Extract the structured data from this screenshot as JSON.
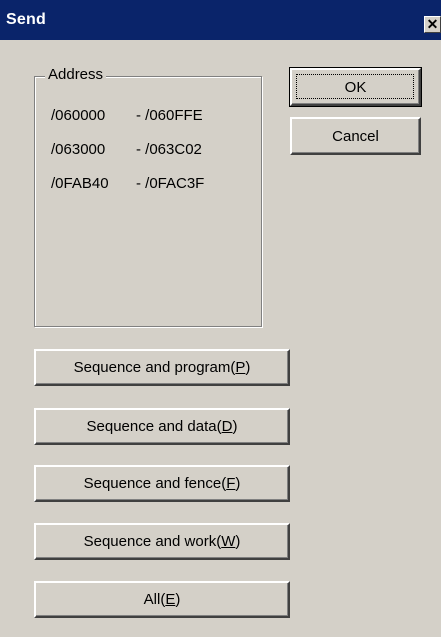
{
  "window": {
    "title": "Send",
    "close_glyph": "✕"
  },
  "address": {
    "legend": "Address",
    "ranges": [
      {
        "from": "/060000",
        "to": "- /060FFE"
      },
      {
        "from": "/063000",
        "to": "- /063C02"
      },
      {
        "from": "/0FAB40",
        "to": "- /0FAC3F"
      }
    ]
  },
  "buttons": {
    "ok": "OK",
    "cancel": "Cancel",
    "seq_program": {
      "label": "Sequence and program(",
      "mnemonic": "P",
      "tail": ")"
    },
    "seq_data": {
      "label": "Sequence and data(",
      "mnemonic": "D",
      "tail": ")"
    },
    "seq_fence": {
      "label": "Sequence and fence(",
      "mnemonic": "F",
      "tail": ")"
    },
    "seq_work": {
      "label": "Sequence and work(",
      "mnemonic": "W",
      "tail": ")"
    },
    "all": {
      "label": "All(",
      "mnemonic": "E",
      "tail": ")"
    }
  }
}
